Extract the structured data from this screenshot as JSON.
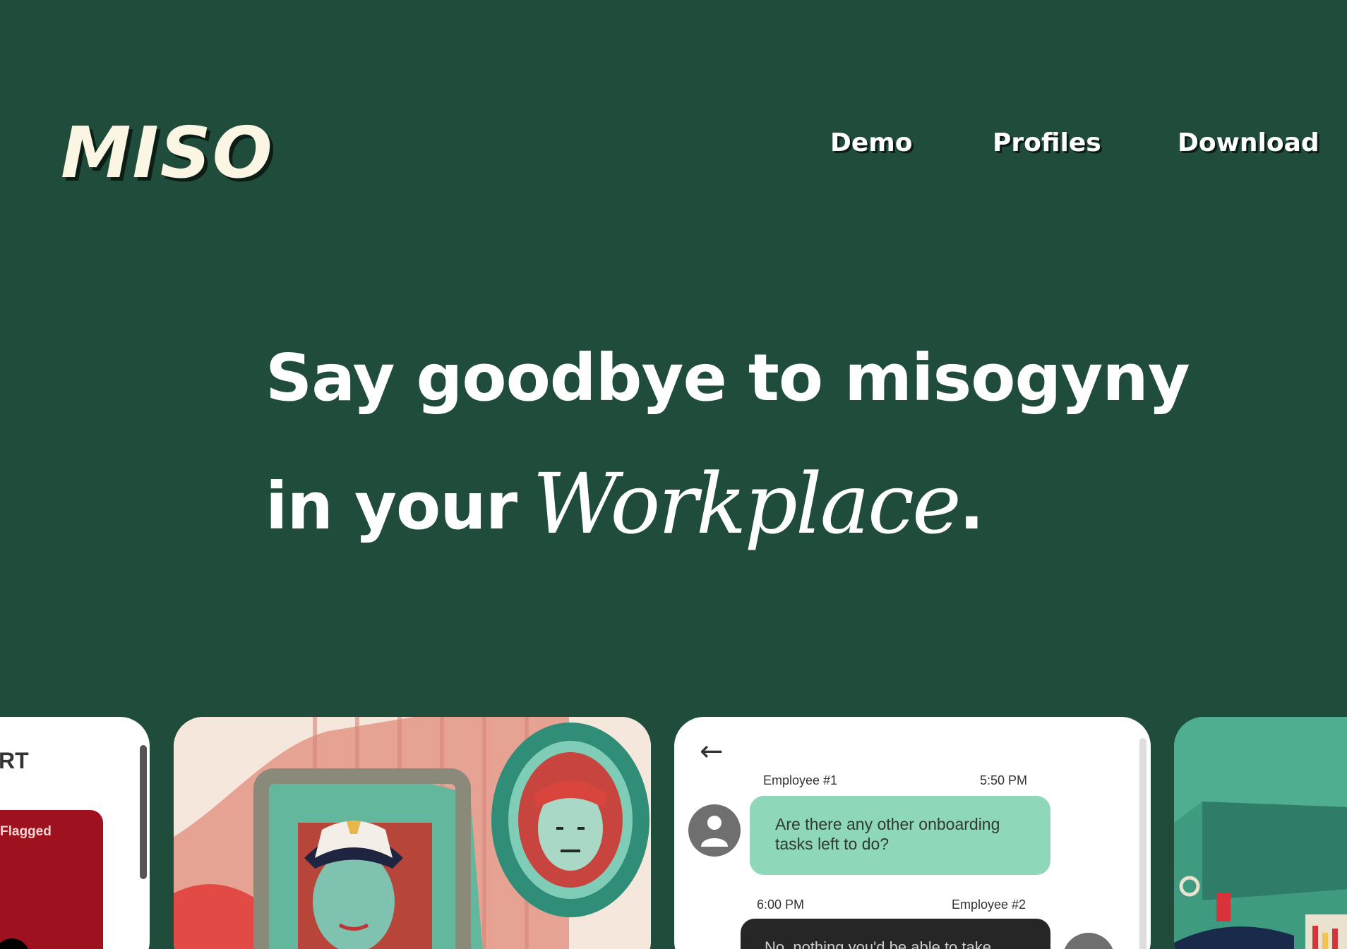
{
  "brand": {
    "logo": "MISO"
  },
  "nav": {
    "items": [
      "Demo",
      "Profiles",
      "Download"
    ]
  },
  "hero": {
    "line1": "Say goodbye to misogyny",
    "line2_prefix": "in your",
    "line2_script": "Workplace",
    "period": "."
  },
  "cards": {
    "report": {
      "title_fragment": "RT",
      "flagged_label": "Flagged"
    },
    "chat": {
      "sender1": "Employee #1",
      "time1": "5:50 PM",
      "message1": "Are there any other onboarding tasks left to do?",
      "time2": "6:00 PM",
      "sender2": "Employee #2",
      "message2": "No, nothing you'd be able to take"
    }
  },
  "colors": {
    "background": "#1f4c3b",
    "logo": "#fbf5e4",
    "bubble": "#8ed7b8",
    "flag": "#9e1220"
  }
}
